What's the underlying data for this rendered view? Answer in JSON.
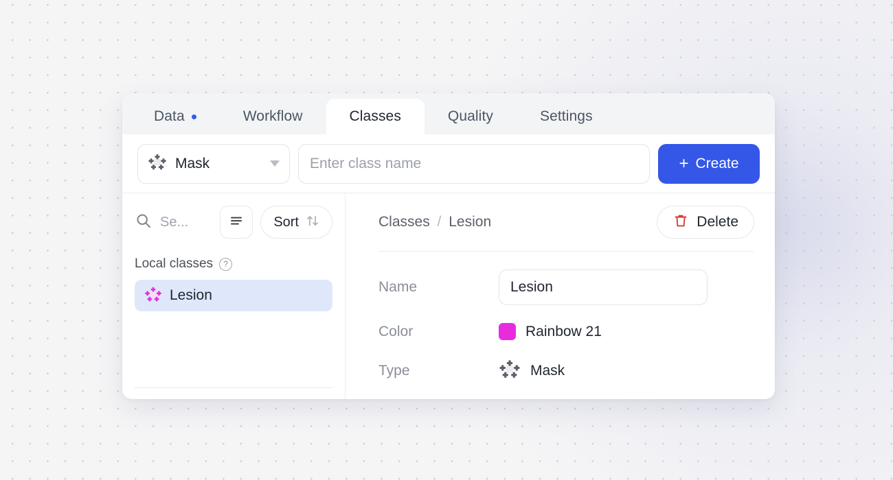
{
  "tabs": [
    {
      "label": "Data",
      "active": false,
      "dot": true
    },
    {
      "label": "Workflow",
      "active": false,
      "dot": false
    },
    {
      "label": "Classes",
      "active": true,
      "dot": false
    },
    {
      "label": "Quality",
      "active": false,
      "dot": false
    },
    {
      "label": "Settings",
      "active": false,
      "dot": false
    }
  ],
  "toolbar": {
    "type_selected": "Mask",
    "type_icon": "mask-icon",
    "class_name_value": "",
    "class_name_placeholder": "Enter class name",
    "create_label": "Create",
    "create_plus": "+",
    "create_color": "#3457e8"
  },
  "left_panel": {
    "search_icon": "search-icon",
    "search_value": "",
    "search_placeholder": "Se...",
    "filter_icon": "filter-icon",
    "sort_label": "Sort",
    "sort_icon": "sort-arrows-icon",
    "section_label": "Local classes",
    "help_icon": "help-circle-icon",
    "help_glyph": "?",
    "classes": [
      {
        "name": "Lesion",
        "icon": "mask-icon",
        "selected": true,
        "color": "#e92be0"
      }
    ]
  },
  "detail": {
    "breadcrumb_root": "Classes",
    "breadcrumb_sep": "/",
    "breadcrumb_current": "Lesion",
    "delete_label": "Delete",
    "delete_icon": "trash-icon",
    "delete_icon_color": "#d93b34",
    "fields": {
      "name_label": "Name",
      "name_value": "Lesion",
      "color_label": "Color",
      "color_value": "Rainbow 21",
      "color_hex": "#e92be0",
      "type_label": "Type",
      "type_value": "Mask",
      "type_icon": "mask-icon"
    }
  }
}
